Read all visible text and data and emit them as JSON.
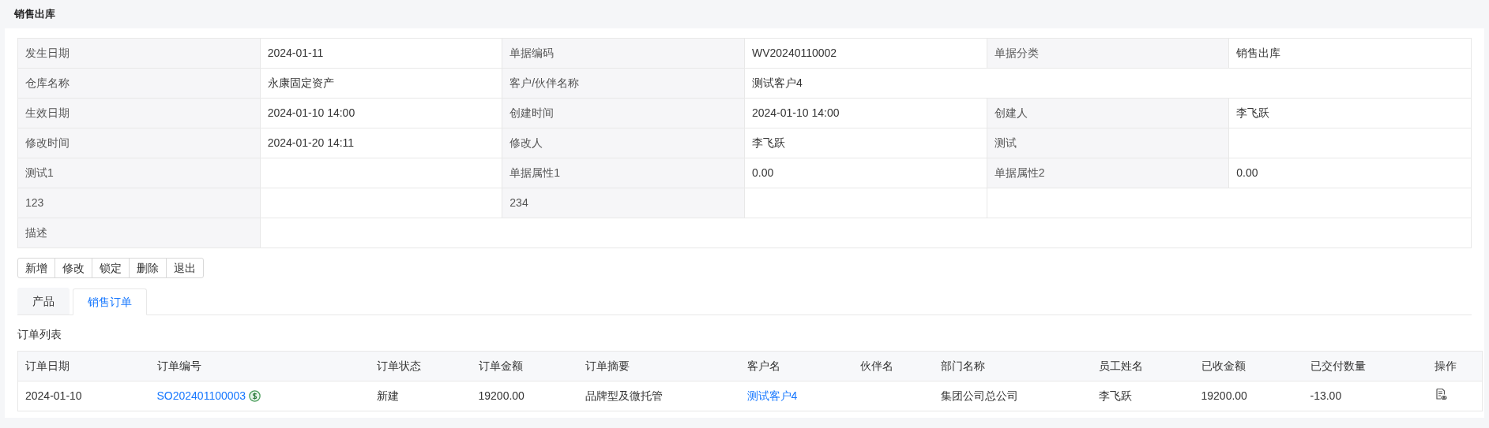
{
  "page_title": "销售出库",
  "detail_rows": [
    [
      {
        "kind": "label",
        "text": "发生日期"
      },
      {
        "kind": "value",
        "text": "2024-01-11"
      },
      {
        "kind": "label",
        "text": "单据编码"
      },
      {
        "kind": "value",
        "text": "WV20240110002"
      },
      {
        "kind": "label",
        "text": "单据分类"
      },
      {
        "kind": "value",
        "text": "销售出库"
      }
    ],
    [
      {
        "kind": "label",
        "text": "仓库名称"
      },
      {
        "kind": "value",
        "text": "永康固定资产"
      },
      {
        "kind": "label",
        "text": "客户/伙伴名称"
      },
      {
        "kind": "value",
        "text": "测试客户4"
      }
    ],
    [
      {
        "kind": "label",
        "text": "生效日期"
      },
      {
        "kind": "value",
        "text": "2024-01-10 14:00"
      },
      {
        "kind": "label",
        "text": "创建时间"
      },
      {
        "kind": "value",
        "text": "2024-01-10 14:00"
      },
      {
        "kind": "label",
        "text": "创建人"
      },
      {
        "kind": "value",
        "text": "李飞跃"
      }
    ],
    [
      {
        "kind": "label",
        "text": "修改时间"
      },
      {
        "kind": "value",
        "text": "2024-01-20 14:11"
      },
      {
        "kind": "label",
        "text": "修改人"
      },
      {
        "kind": "value",
        "text": "李飞跃"
      },
      {
        "kind": "label",
        "text": "测试"
      },
      {
        "kind": "value"
      }
    ],
    [
      {
        "kind": "label",
        "text": "测试1"
      },
      {
        "kind": "value"
      },
      {
        "kind": "label",
        "text": "单据属性1"
      },
      {
        "kind": "value",
        "text": "0.00"
      },
      {
        "kind": "label",
        "text": "单据属性2"
      },
      {
        "kind": "value",
        "text": "0.00"
      }
    ],
    [
      {
        "kind": "label",
        "text": "123"
      },
      {
        "kind": "value"
      },
      {
        "kind": "label",
        "text": "234"
      },
      {
        "kind": "value"
      },
      {
        "kind": "value"
      }
    ],
    [
      {
        "kind": "label",
        "text": "描述"
      },
      {
        "kind": "value"
      }
    ]
  ],
  "buttons": [
    "新增",
    "修改",
    "锁定",
    "删除",
    "退出"
  ],
  "tabs": [
    {
      "label": "产品",
      "selected": false
    },
    {
      "label": "销售订单",
      "selected": true
    }
  ],
  "section_title": "订单列表",
  "order_table": {
    "columns": [
      "订单日期",
      "订单编号",
      "订单状态",
      "订单金额",
      "订单摘要",
      "客户名",
      "伙伴名",
      "部门名称",
      "员工姓名",
      "已收金额",
      "已交付数量",
      "操作"
    ],
    "rows": [
      [
        {
          "kind": "text",
          "text": "2024-01-10"
        },
        {
          "kind": "link",
          "text": "SO202401100003",
          "paid": true
        },
        {
          "kind": "text",
          "text": "新建"
        },
        {
          "kind": "text",
          "text": "19200.00"
        },
        {
          "kind": "text",
          "text": "品牌型及微托管"
        },
        {
          "kind": "link",
          "text": "测试客户4"
        },
        {
          "kind": "text"
        },
        {
          "kind": "text",
          "text": "集团公司总公司"
        },
        {
          "kind": "text",
          "text": "李飞跃"
        },
        {
          "kind": "text",
          "text": "19200.00"
        },
        {
          "kind": "text",
          "text": "-13.00"
        },
        {
          "kind": "action"
        }
      ]
    ]
  }
}
